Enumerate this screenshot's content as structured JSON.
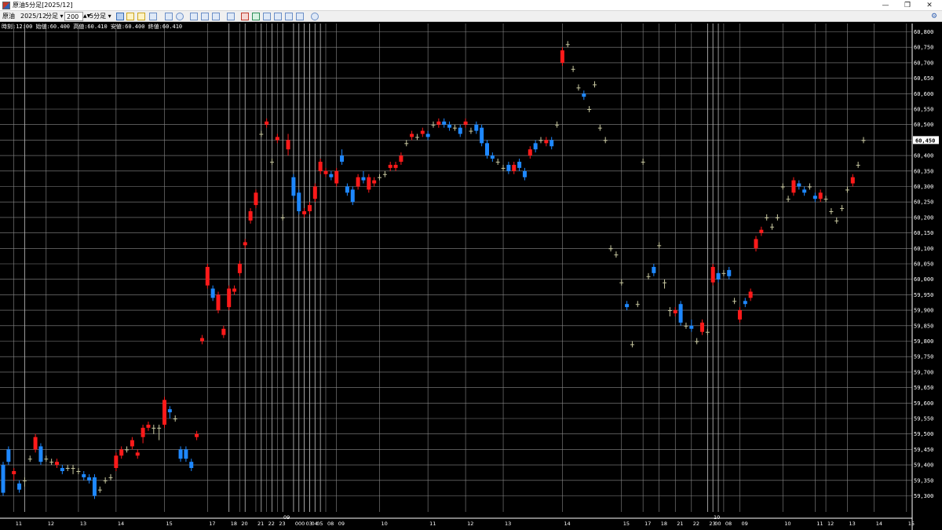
{
  "window": {
    "title": "原油5分足[2025/12]",
    "min_icon": "minimize-icon",
    "max_icon": "restore-icon",
    "close_icon": "close-icon"
  },
  "toolbar": {
    "symbol": "原油",
    "contract": "2025/12",
    "bar_type": "分足",
    "count": "200",
    "interval": "5分足",
    "icons": [
      "cursor-icon",
      "hand-icon",
      "pencil-icon",
      "line-draw-icon",
      "zoom-icon",
      "globe-icon",
      "grid-icon",
      "table-icon",
      "table2-icon",
      "bar-chart-icon",
      "indicator-icon",
      "chart1-icon",
      "chart2-icon",
      "chart3-icon",
      "chart4-icon",
      "chart5-icon",
      "refresh-icon"
    ],
    "right_icon": "settings-icon"
  },
  "info": {
    "text": "時刻:12:00 始値:60.400 高値:60.410 安値:60.400 終値:60.410"
  },
  "chart_data": {
    "type": "candlestick",
    "up_color": "#ff1a1a",
    "down_color": "#1e88ff",
    "doji_color": "#c8c8a0",
    "grid_color": "#8a8a8a",
    "ylim": [
      59.26,
      60.82
    ],
    "y_ticks": [
      "60,800",
      "60,750",
      "60,700",
      "60,650",
      "60,600",
      "60,550",
      "60,500",
      "60,450",
      "60,400",
      "60,350",
      "60,300",
      "60,250",
      "60,200",
      "60,150",
      "60,100",
      "60,050",
      "60,000",
      "59,950",
      "59,900",
      "59,850",
      "59,800",
      "59,750",
      "59,700",
      "59,650",
      "59,600",
      "59,550",
      "59,500",
      "59,450",
      "59,400",
      "59,350",
      "59,300"
    ],
    "last_price": "60,450",
    "last_value": 60.45,
    "x_labels": [
      {
        "i": 2,
        "text": "11"
      },
      {
        "i": 8,
        "text": "12"
      },
      {
        "i": 14,
        "text": "13"
      },
      {
        "i": 21,
        "text": "14"
      },
      {
        "i": 30,
        "text": "15"
      },
      {
        "i": 38,
        "text": "17"
      },
      {
        "i": 42,
        "text": "18"
      },
      {
        "i": 44,
        "text": "20"
      },
      {
        "i": 47,
        "text": "21"
      },
      {
        "i": 49,
        "text": "22"
      },
      {
        "i": 51,
        "text": "23"
      },
      {
        "i": 54,
        "text": "000"
      },
      {
        "i": 56,
        "text": "03"
      },
      {
        "i": 57,
        "text": "04"
      },
      {
        "i": 58,
        "text": "05"
      },
      {
        "i": 60,
        "text": "08"
      },
      {
        "i": 62,
        "text": "09"
      },
      {
        "i": 70,
        "text": "10"
      },
      {
        "i": 79,
        "text": "11"
      },
      {
        "i": 86,
        "text": "12"
      },
      {
        "i": 93,
        "text": "13"
      },
      {
        "i": 104,
        "text": "14"
      },
      {
        "i": 115,
        "text": "15"
      },
      {
        "i": 119,
        "text": "17"
      },
      {
        "i": 122,
        "text": "18"
      },
      {
        "i": 125,
        "text": "21"
      },
      {
        "i": 128,
        "text": "22"
      },
      {
        "i": 131,
        "text": "23"
      },
      {
        "i": 132,
        "text": "00"
      },
      {
        "i": 134,
        "text": "08"
      },
      {
        "i": 137,
        "text": "09"
      },
      {
        "i": 145,
        "text": "10"
      },
      {
        "i": 151,
        "text": "11"
      },
      {
        "i": 153,
        "text": "12"
      },
      {
        "i": 157,
        "text": "13"
      },
      {
        "i": 162,
        "text": "14"
      },
      {
        "i": 168,
        "text": "15"
      }
    ],
    "date_labels": [
      {
        "i": 53,
        "text": "09"
      },
      {
        "i": 133,
        "text": "10"
      }
    ],
    "day_lines": [
      4,
      42,
      45,
      48,
      50,
      52,
      54,
      55,
      56,
      57,
      58,
      59,
      131,
      132,
      133
    ],
    "candles": [
      [
        59.4,
        59.31,
        59.3,
        59.41
      ],
      [
        59.45,
        59.41,
        59.4,
        59.46
      ],
      [
        59.37,
        59.38,
        59.35,
        59.39
      ],
      [
        59.34,
        59.32,
        59.31,
        59.35
      ],
      [
        59.35,
        59.35,
        59.33,
        59.36
      ],
      [
        59.42,
        59.42,
        59.41,
        59.43
      ],
      [
        59.45,
        59.49,
        59.44,
        59.5
      ],
      [
        59.46,
        59.41,
        59.4,
        59.47
      ],
      [
        59.42,
        59.42,
        59.41,
        59.43
      ],
      [
        59.41,
        59.41,
        59.4,
        59.42
      ],
      [
        59.4,
        59.41,
        59.39,
        59.42
      ],
      [
        59.39,
        59.38,
        59.37,
        59.4
      ],
      [
        59.39,
        59.39,
        59.38,
        59.4
      ],
      [
        59.39,
        59.39,
        59.37,
        59.4
      ],
      [
        59.38,
        59.38,
        59.37,
        59.39
      ],
      [
        59.37,
        59.36,
        59.35,
        59.38
      ],
      [
        59.36,
        59.35,
        59.34,
        59.37
      ],
      [
        59.36,
        59.3,
        59.29,
        59.37
      ],
      [
        59.32,
        59.32,
        59.31,
        59.33
      ],
      [
        59.35,
        59.35,
        59.34,
        59.36
      ],
      [
        59.36,
        59.36,
        59.35,
        59.37
      ],
      [
        59.39,
        59.43,
        59.38,
        59.44
      ],
      [
        59.43,
        59.45,
        59.42,
        59.46
      ],
      [
        59.45,
        59.45,
        59.44,
        59.46
      ],
      [
        59.46,
        59.48,
        59.45,
        59.49
      ],
      [
        59.43,
        59.44,
        59.42,
        59.45
      ],
      [
        59.49,
        59.52,
        59.47,
        59.53
      ],
      [
        59.52,
        59.53,
        59.51,
        59.54
      ],
      [
        59.52,
        59.52,
        59.5,
        59.53
      ],
      [
        59.52,
        59.52,
        59.48,
        59.53
      ],
      [
        59.53,
        59.61,
        59.52,
        59.62
      ],
      [
        59.58,
        59.57,
        59.55,
        59.59
      ],
      [
        59.55,
        59.55,
        59.54,
        59.56
      ],
      [
        59.45,
        59.42,
        59.41,
        59.46
      ],
      [
        59.45,
        59.42,
        59.41,
        59.46
      ],
      [
        59.41,
        59.39,
        59.38,
        59.42
      ],
      [
        59.49,
        59.5,
        59.48,
        59.51
      ],
      [
        59.8,
        59.81,
        59.79,
        59.82
      ],
      [
        59.98,
        60.04,
        59.97,
        60.05
      ],
      [
        59.97,
        59.94,
        59.93,
        59.98
      ],
      [
        59.9,
        59.95,
        59.89,
        59.96
      ],
      [
        59.82,
        59.84,
        59.81,
        59.85
      ],
      [
        59.91,
        59.97,
        59.9,
        59.98
      ],
      [
        59.96,
        59.97,
        59.95,
        59.98
      ],
      [
        60.02,
        60.05,
        60.01,
        60.06
      ],
      [
        60.11,
        60.12,
        60.1,
        60.13
      ],
      [
        60.19,
        60.22,
        60.18,
        60.23
      ],
      [
        60.24,
        60.28,
        60.23,
        60.29
      ],
      [
        60.47,
        60.47,
        60.46,
        60.48
      ],
      [
        60.5,
        60.51,
        60.49,
        60.52
      ],
      [
        60.38,
        60.38,
        60.37,
        60.39
      ],
      [
        60.45,
        60.46,
        60.44,
        60.47
      ],
      [
        60.2,
        60.2,
        60.19,
        60.21
      ],
      [
        60.42,
        60.45,
        60.4,
        60.47
      ],
      [
        60.33,
        60.27,
        60.26,
        60.34
      ],
      [
        60.28,
        60.22,
        60.21,
        60.29
      ],
      [
        60.21,
        60.22,
        60.2,
        60.23
      ],
      [
        60.22,
        60.24,
        60.21,
        60.25
      ],
      [
        60.26,
        60.3,
        60.25,
        60.31
      ],
      [
        60.35,
        60.38,
        60.34,
        60.39
      ],
      [
        60.34,
        60.35,
        60.33,
        60.36
      ],
      [
        60.34,
        60.33,
        60.32,
        60.35
      ],
      [
        60.31,
        60.35,
        60.3,
        60.36
      ],
      [
        60.4,
        60.38,
        60.37,
        60.42
      ],
      [
        60.3,
        60.28,
        60.27,
        60.31
      ],
      [
        60.29,
        60.25,
        60.24,
        60.3
      ],
      [
        60.3,
        60.33,
        60.29,
        60.34
      ],
      [
        60.33,
        60.32,
        60.31,
        60.35
      ],
      [
        60.29,
        60.33,
        60.28,
        60.34
      ],
      [
        60.31,
        60.32,
        60.3,
        60.33
      ],
      [
        60.33,
        60.33,
        60.32,
        60.34
      ],
      [
        60.34,
        60.34,
        60.33,
        60.35
      ],
      [
        60.36,
        60.37,
        60.35,
        60.38
      ],
      [
        60.36,
        60.37,
        60.35,
        60.38
      ],
      [
        60.38,
        60.4,
        60.37,
        60.41
      ],
      [
        60.44,
        60.44,
        60.43,
        60.45
      ],
      [
        60.46,
        60.47,
        60.45,
        60.48
      ],
      [
        60.46,
        60.46,
        60.45,
        60.47
      ],
      [
        60.47,
        60.48,
        60.46,
        60.49
      ],
      [
        60.47,
        60.46,
        60.45,
        60.48
      ],
      [
        60.5,
        60.5,
        60.49,
        60.51
      ],
      [
        60.5,
        60.51,
        60.49,
        60.52
      ],
      [
        60.51,
        60.5,
        60.49,
        60.52
      ],
      [
        60.5,
        60.49,
        60.48,
        60.51
      ],
      [
        60.49,
        60.49,
        60.48,
        60.5
      ],
      [
        60.49,
        60.47,
        60.46,
        60.5
      ],
      [
        60.5,
        60.51,
        60.49,
        60.52
      ],
      [
        60.48,
        60.48,
        60.47,
        60.49
      ],
      [
        60.5,
        60.48,
        60.47,
        60.51
      ],
      [
        60.49,
        60.44,
        60.43,
        60.5
      ],
      [
        60.44,
        60.4,
        60.39,
        60.45
      ],
      [
        60.4,
        60.39,
        60.38,
        60.41
      ],
      [
        60.38,
        60.38,
        60.37,
        60.39
      ],
      [
        60.36,
        60.36,
        60.35,
        60.37
      ],
      [
        60.37,
        60.35,
        60.34,
        60.38
      ],
      [
        60.35,
        60.37,
        60.34,
        60.38
      ],
      [
        60.38,
        60.36,
        60.35,
        60.39
      ],
      [
        60.35,
        60.33,
        60.32,
        60.36
      ],
      [
        60.4,
        60.42,
        60.39,
        60.43
      ],
      [
        60.44,
        60.42,
        60.41,
        60.45
      ],
      [
        60.45,
        60.45,
        60.44,
        60.46
      ],
      [
        60.44,
        60.45,
        60.43,
        60.46
      ],
      [
        60.45,
        60.43,
        60.42,
        60.46
      ],
      [
        60.5,
        60.5,
        60.49,
        60.51
      ],
      [
        60.7,
        60.74,
        60.69,
        60.75
      ],
      [
        60.76,
        60.76,
        60.75,
        60.77
      ],
      [
        60.68,
        60.68,
        60.67,
        60.69
      ],
      [
        60.62,
        60.62,
        60.61,
        60.63
      ],
      [
        60.6,
        60.59,
        60.58,
        60.61
      ],
      [
        60.55,
        60.55,
        60.54,
        60.56
      ],
      [
        60.63,
        60.63,
        60.62,
        60.64
      ],
      [
        60.49,
        60.49,
        60.48,
        60.5
      ],
      [
        60.45,
        60.45,
        60.44,
        60.46
      ],
      [
        60.1,
        60.1,
        60.09,
        60.11
      ],
      [
        60.08,
        60.08,
        60.07,
        60.09
      ],
      [
        59.99,
        59.99,
        59.98,
        60.0
      ],
      [
        59.92,
        59.91,
        59.9,
        59.93
      ],
      [
        59.79,
        59.79,
        59.78,
        59.8
      ],
      [
        59.92,
        59.92,
        59.91,
        59.93
      ],
      [
        60.38,
        60.38,
        60.37,
        60.39
      ],
      [
        60.01,
        60.01,
        60.0,
        60.02
      ],
      [
        60.04,
        60.02,
        60.01,
        60.05
      ],
      [
        60.11,
        60.11,
        60.1,
        60.12
      ],
      [
        59.99,
        59.99,
        59.97,
        60.0
      ],
      [
        59.9,
        59.9,
        59.88,
        59.91
      ],
      [
        59.89,
        59.9,
        59.88,
        59.91
      ],
      [
        59.92,
        59.86,
        59.85,
        59.93
      ],
      [
        59.85,
        59.85,
        59.84,
        59.86
      ],
      [
        59.85,
        59.84,
        59.83,
        59.87
      ],
      [
        59.8,
        59.8,
        59.79,
        59.81
      ],
      [
        59.83,
        59.86,
        59.82,
        59.87
      ],
      [
        59.83,
        59.83,
        59.82,
        59.84
      ],
      [
        59.99,
        60.04,
        59.98,
        60.05
      ],
      [
        60.02,
        60.0,
        59.99,
        60.03
      ],
      [
        60.02,
        60.02,
        60.01,
        60.03
      ],
      [
        60.03,
        60.01,
        60.0,
        60.04
      ],
      [
        59.93,
        59.93,
        59.92,
        59.94
      ],
      [
        59.87,
        59.9,
        59.86,
        59.91
      ],
      [
        59.93,
        59.92,
        59.91,
        59.94
      ],
      [
        59.94,
        59.96,
        59.93,
        59.97
      ],
      [
        60.1,
        60.13,
        60.09,
        60.14
      ],
      [
        60.15,
        60.16,
        60.14,
        60.17
      ],
      [
        60.2,
        60.2,
        60.19,
        60.21
      ],
      [
        60.17,
        60.17,
        60.16,
        60.18
      ],
      [
        60.2,
        60.2,
        60.19,
        60.21
      ],
      [
        60.3,
        60.3,
        60.29,
        60.31
      ],
      [
        60.26,
        60.26,
        60.25,
        60.27
      ],
      [
        60.28,
        60.32,
        60.27,
        60.33
      ],
      [
        60.31,
        60.3,
        60.29,
        60.32
      ],
      [
        60.29,
        60.28,
        60.27,
        60.3
      ],
      [
        60.3,
        60.3,
        60.29,
        60.31
      ],
      [
        60.27,
        60.26,
        60.25,
        60.28
      ],
      [
        60.26,
        60.28,
        60.25,
        60.29
      ],
      [
        60.26,
        60.26,
        60.25,
        60.27
      ],
      [
        60.22,
        60.22,
        60.21,
        60.23
      ],
      [
        60.19,
        60.19,
        60.18,
        60.2
      ],
      [
        60.23,
        60.23,
        60.22,
        60.24
      ],
      [
        60.29,
        60.29,
        60.28,
        60.3
      ],
      [
        60.31,
        60.33,
        60.3,
        60.34
      ],
      [
        60.37,
        60.37,
        60.36,
        60.38
      ],
      [
        60.45,
        60.45,
        60.44,
        60.46
      ]
    ]
  }
}
